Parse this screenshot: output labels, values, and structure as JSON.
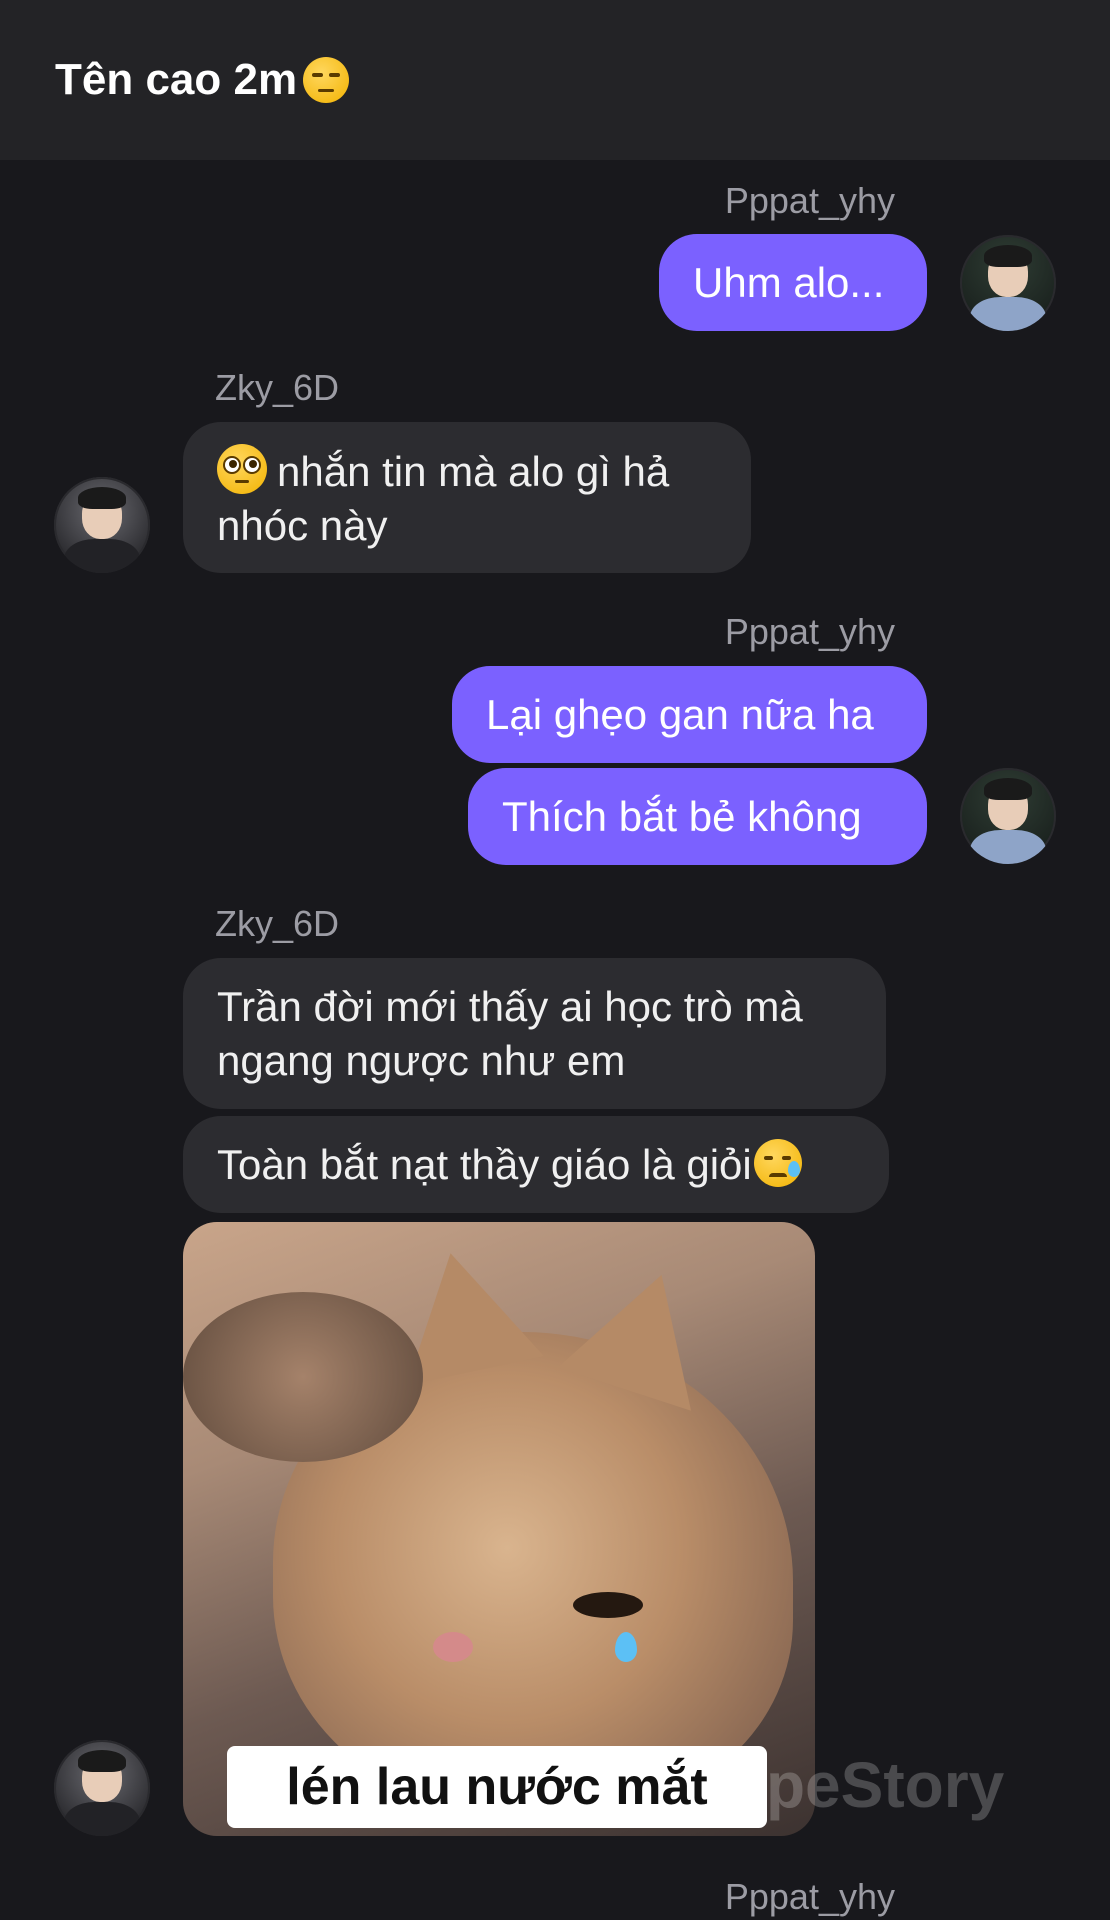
{
  "header": {
    "title": "Tên cao 2m",
    "title_emoji": "unamused-face-emoji"
  },
  "messages": [
    {
      "sender": "Pppat_yhy",
      "side": "right",
      "text": "Uhm alo..."
    },
    {
      "sender": "Zky_6D",
      "side": "left",
      "emoji": "face-with-rolling-eyes-emoji",
      "text": "nhắn tin mà alo gì hả nhóc này"
    },
    {
      "sender": "Pppat_yhy",
      "side": "right",
      "texts": [
        "Lại ghẹo gan nữa ha",
        "Thích bắt bẻ không"
      ]
    },
    {
      "sender": "Zky_6D",
      "side": "left",
      "texts": [
        "Trần đời mới thấy ai học trò mà ngang ngược như em",
        "Toàn bắt nạt thầy giáo là giỏi"
      ],
      "trailing_emoji": "crying-face-emoji",
      "image": {
        "description": "crying-cat-sticker",
        "caption": "lén lau nước mắt"
      }
    },
    {
      "sender": "Pppat_yhy",
      "side": "right"
    }
  ],
  "watermark": "TypeStory",
  "colors": {
    "outgoing_bubble": "#7b61ff",
    "incoming_bubble": "#2c2c30",
    "background": "#18181c",
    "header": "#232326"
  }
}
